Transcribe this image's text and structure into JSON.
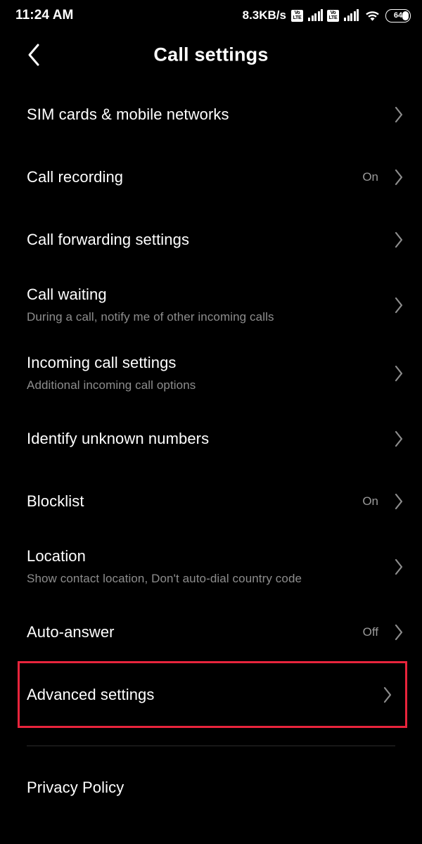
{
  "status_bar": {
    "time": "11:24 AM",
    "network_speed": "8.3KB/s",
    "volte_top": "Vo",
    "volte_bottom": "LTE",
    "battery_level": "64"
  },
  "header": {
    "title": "Call settings",
    "back_icon": "chevron-left-icon"
  },
  "list": {
    "items": [
      {
        "title": "SIM cards & mobile networks",
        "subtitle": "",
        "value": "",
        "highlighted": false
      },
      {
        "title": "Call recording",
        "subtitle": "",
        "value": "On",
        "highlighted": false
      },
      {
        "title": "Call forwarding settings",
        "subtitle": "",
        "value": "",
        "highlighted": false
      },
      {
        "title": "Call waiting",
        "subtitle": "During a call, notify me of other incoming calls",
        "value": "",
        "highlighted": false
      },
      {
        "title": "Incoming call settings",
        "subtitle": "Additional incoming call options",
        "value": "",
        "highlighted": false
      },
      {
        "title": "Identify unknown numbers",
        "subtitle": "",
        "value": "",
        "highlighted": false
      },
      {
        "title": "Blocklist",
        "subtitle": "",
        "value": "On",
        "highlighted": false
      },
      {
        "title": "Location",
        "subtitle": "Show contact location, Don't auto-dial country code",
        "value": "",
        "highlighted": false
      },
      {
        "title": "Auto-answer",
        "subtitle": "",
        "value": "Off",
        "highlighted": false
      },
      {
        "title": "Advanced settings",
        "subtitle": "",
        "value": "",
        "highlighted": true
      }
    ]
  },
  "footer": {
    "privacy_policy": "Privacy Policy"
  },
  "colors": {
    "background": "#000000",
    "primary_text": "#ffffff",
    "secondary_text": "#8d8d8d",
    "chevron": "#8d8d8d",
    "highlight_border": "#e8243c",
    "divider": "#2b2b2b"
  }
}
